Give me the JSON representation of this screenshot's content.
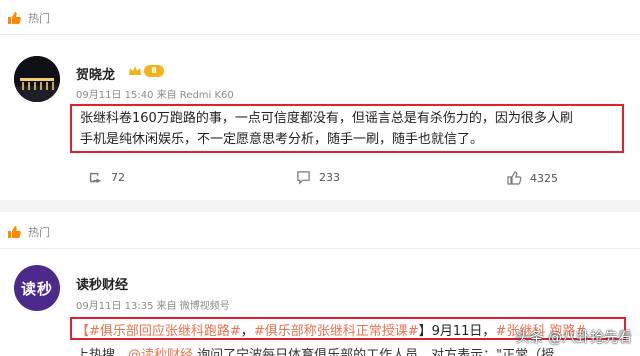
{
  "post1": {
    "section_label": "热门",
    "username": "贺晓龙",
    "badge_level": "Ⅱ",
    "meta": "09月11日 15:40 来自 Redmi K60",
    "text_line1": "张继科卷160万跑路的事，一点可信度都没有，但谣言总是有杀伤力的，因为很多人刷",
    "text_line2": "手机是纯休闲娱乐，不一定愿意思考分析，随手一刷，随手也就信了。",
    "reposts": "72",
    "comments": "233",
    "likes": "4325"
  },
  "post2": {
    "section_label": "热门",
    "avatar_text": "读秒",
    "username": "读秒财经",
    "meta": "09月11日 13:35 来自 微博视频号",
    "tag1": "【#俱乐部回应张继科跑路#",
    "sep": "，",
    "tag2": "#俱乐部称张继科正常授课#",
    "date_text": "】9月11日，",
    "tag3": "#张继科 跑路#",
    "line2_prefix": "上热搜，",
    "line2_link": "@读秒财经",
    "line2_rest": " 询问了宁波每日体育俱乐部的工作人员，对方表示：\"正常（授"
  },
  "watermark": "头条 @八卦抢先看",
  "colors": {
    "highlight_border": "#e0202c",
    "tag": "#eb7350",
    "badge": "#f2b21b"
  }
}
